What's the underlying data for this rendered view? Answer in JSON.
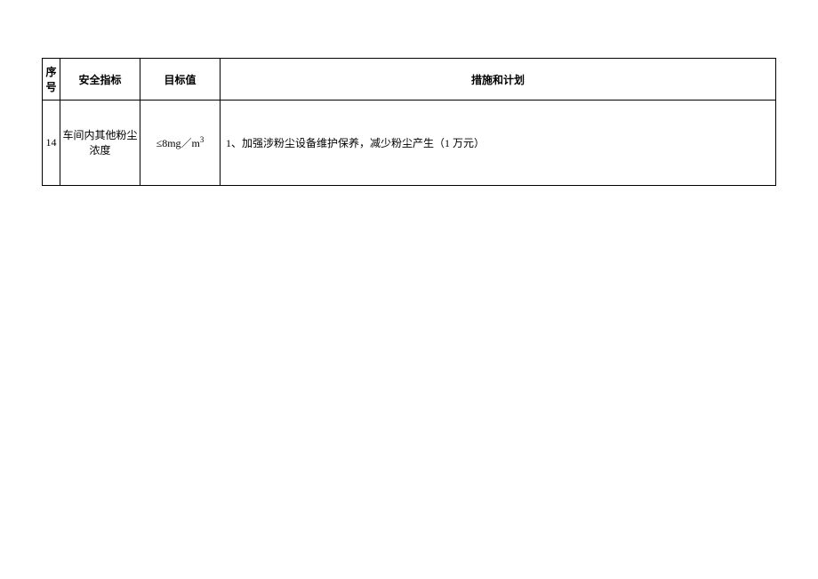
{
  "table": {
    "headers": {
      "seq": "序号",
      "indicator": "安全指标",
      "target": "目标值",
      "measures": "措施和计划"
    },
    "rows": [
      {
        "seq": "14",
        "indicator": "车间内其他粉尘浓度",
        "target_prefix": "≤8mg／m",
        "target_sup": "3",
        "measures": "1、加强涉粉尘设备维护保养，减少粉尘产生（1 万元）"
      }
    ]
  }
}
